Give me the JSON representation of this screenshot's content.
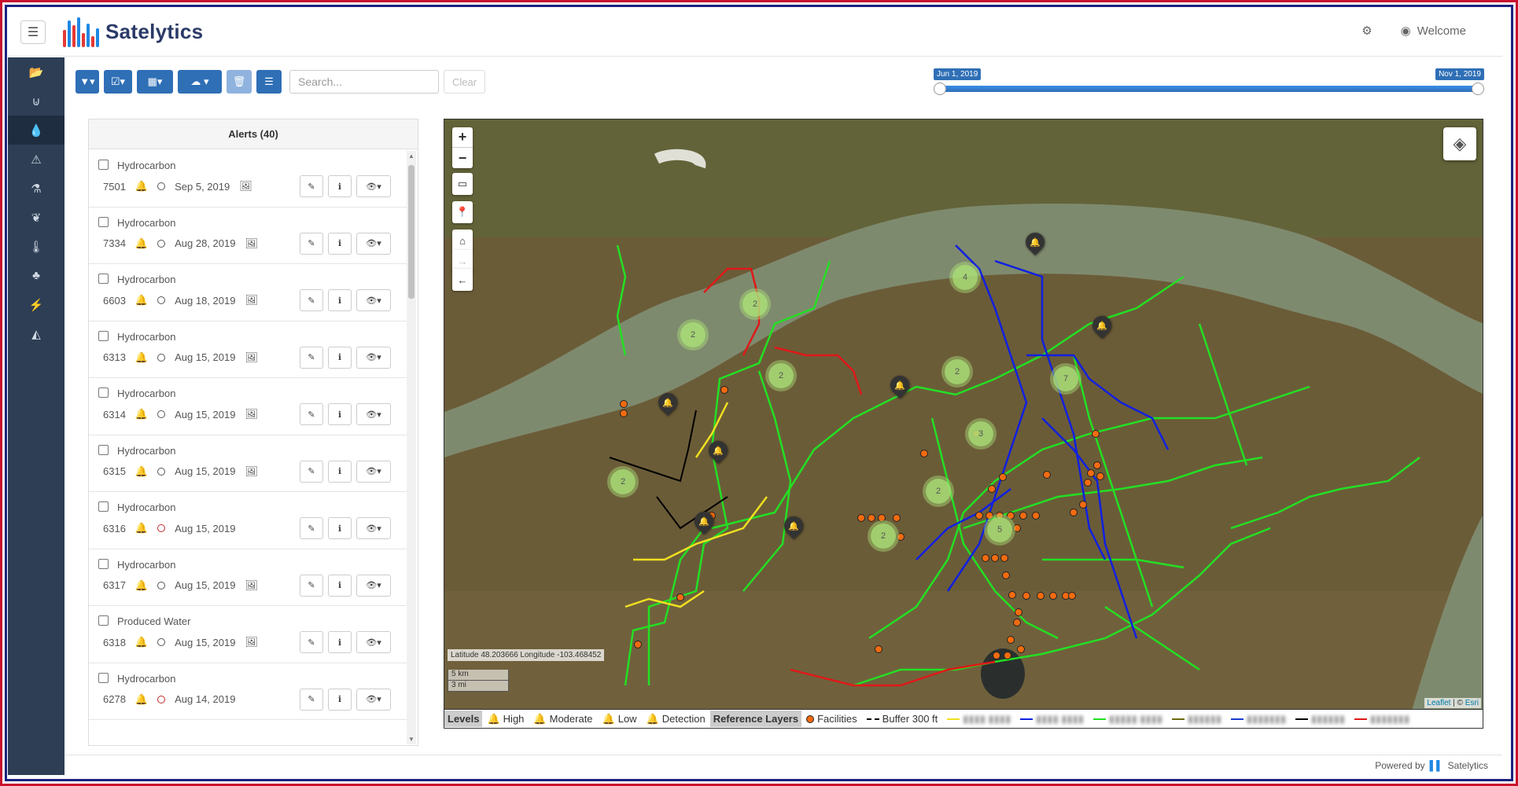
{
  "app": {
    "name": "Satelytics",
    "welcome": "Welcome"
  },
  "sidebar": {
    "items": [
      {
        "icon": "folder-open-icon",
        "glyph": "📂"
      },
      {
        "icon": "magnet-icon",
        "glyph": "⊍"
      },
      {
        "icon": "droplet-icon",
        "glyph": "💧",
        "active": true
      },
      {
        "icon": "warning-icon",
        "glyph": "⚠"
      },
      {
        "icon": "flask-icon",
        "glyph": "⚗"
      },
      {
        "icon": "leaf-icon",
        "glyph": "❦"
      },
      {
        "icon": "thermometer-icon",
        "glyph": "🌡"
      },
      {
        "icon": "tree-icon",
        "glyph": "♣"
      },
      {
        "icon": "bolt-icon",
        "glyph": "⚡"
      },
      {
        "icon": "area-chart-icon",
        "glyph": "◭"
      }
    ]
  },
  "toolbar": {
    "search_placeholder": "Search...",
    "clear_label": "Clear"
  },
  "timeline": {
    "start_label": "Jun 1, 2019",
    "end_label": "Nov 1, 2019"
  },
  "alerts": {
    "title": "Alerts (40)",
    "items": [
      {
        "type": "Hydrocarbon",
        "id": "7501",
        "date": "Sep 5, 2019",
        "status": "normal",
        "image": true
      },
      {
        "type": "Hydrocarbon",
        "id": "7334",
        "date": "Aug 28, 2019",
        "status": "normal",
        "image": true
      },
      {
        "type": "Hydrocarbon",
        "id": "6603",
        "date": "Aug 18, 2019",
        "status": "normal",
        "image": true
      },
      {
        "type": "Hydrocarbon",
        "id": "6313",
        "date": "Aug 15, 2019",
        "status": "normal",
        "image": true
      },
      {
        "type": "Hydrocarbon",
        "id": "6314",
        "date": "Aug 15, 2019",
        "status": "normal",
        "image": true
      },
      {
        "type": "Hydrocarbon",
        "id": "6315",
        "date": "Aug 15, 2019",
        "status": "normal",
        "image": true
      },
      {
        "type": "Hydrocarbon",
        "id": "6316",
        "date": "Aug 15, 2019",
        "status": "red",
        "image": false
      },
      {
        "type": "Hydrocarbon",
        "id": "6317",
        "date": "Aug 15, 2019",
        "status": "normal",
        "image": true
      },
      {
        "type": "Produced Water",
        "id": "6318",
        "date": "Aug 15, 2019",
        "status": "normal",
        "image": true
      },
      {
        "type": "Hydrocarbon",
        "id": "6278",
        "date": "Aug 14, 2019",
        "status": "red",
        "image": false
      }
    ]
  },
  "map": {
    "coords": "Latitude 48.203666 Longitude -103.468452",
    "scale_km": "5 km",
    "scale_mi": "3 mi",
    "attribution_leaflet": "Leaflet",
    "attribution_sep": " | © ",
    "attribution_esri": "Esri",
    "clusters": [
      "2",
      "2",
      "2",
      "4",
      "2",
      "7",
      "3",
      "2",
      "2",
      "2",
      "5"
    ]
  },
  "legend": {
    "levels_label": "Levels",
    "high": "High",
    "moderate": "Moderate",
    "low": "Low",
    "detection": "Detection",
    "reference_label": "Reference Layers",
    "facilities": "Facilities",
    "buffer": "Buffer 300 ft",
    "colors": {
      "high": "#e53935",
      "moderate": "#fb8c00",
      "low": "#1e88e5",
      "detection": "#222222"
    }
  },
  "footer": {
    "powered_by": "Powered by",
    "brand": "Satelytics"
  }
}
